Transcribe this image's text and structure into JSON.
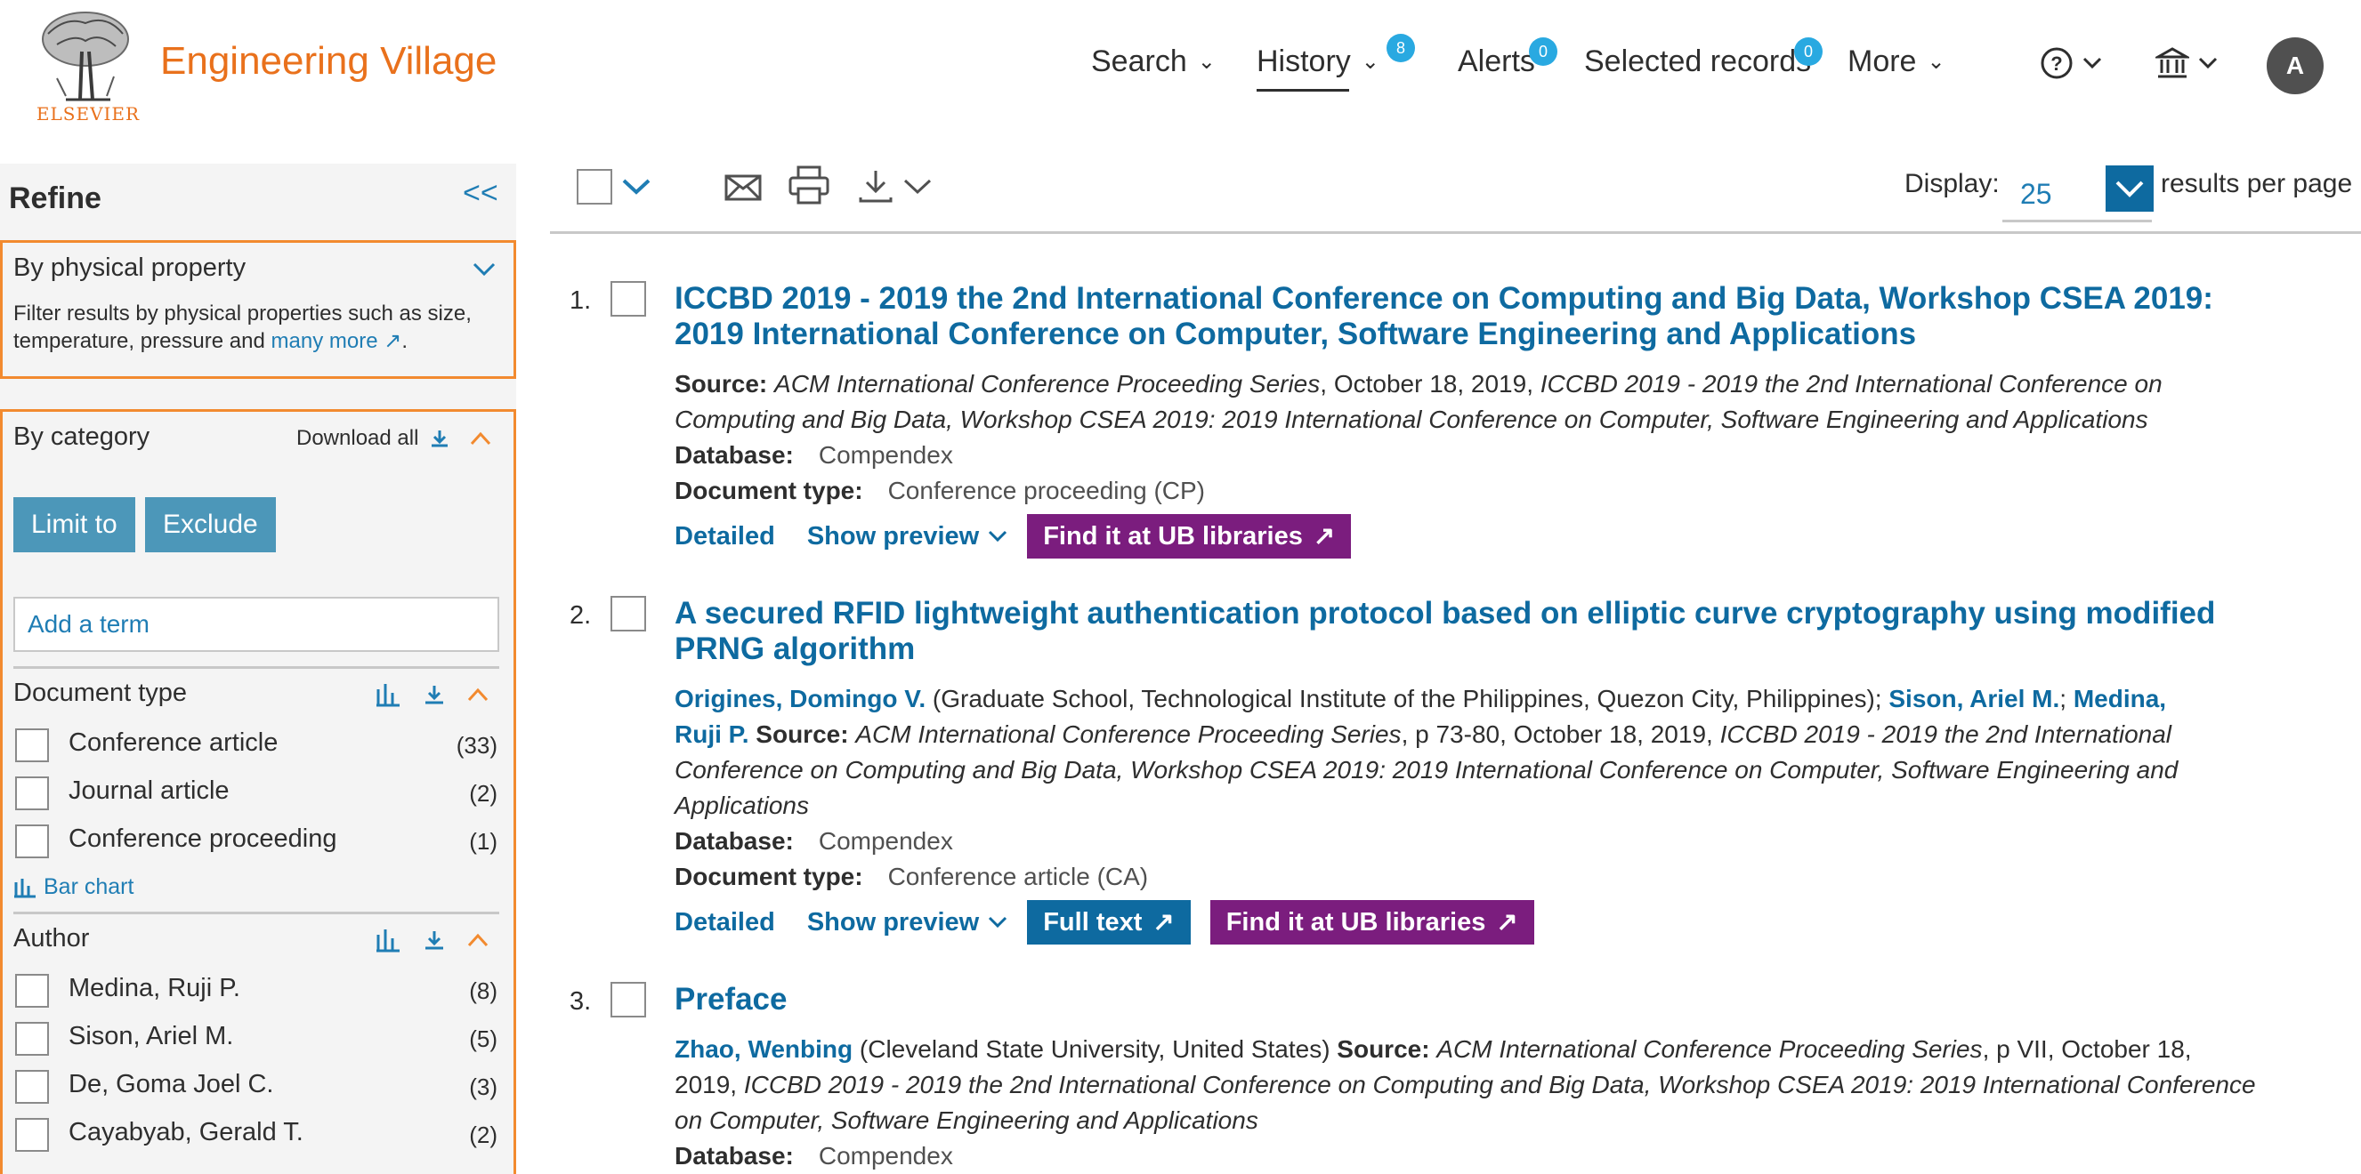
{
  "header": {
    "logo_text": "ELSEVIER",
    "brand": "Engineering Village",
    "nav": [
      {
        "label": "Search"
      },
      {
        "label": "History",
        "badge": "8"
      },
      {
        "label": "Alerts",
        "badge": "0"
      },
      {
        "label": "Selected records",
        "badge": "0"
      },
      {
        "label": "More"
      }
    ],
    "avatar": "A",
    "icons": [
      "help-icon",
      "institution-icon"
    ]
  },
  "sidebar": {
    "title": "Refine",
    "collapse": "<<",
    "physical": {
      "heading": "By physical property",
      "desc_1": "Filter results by physical properties such as size,",
      "desc_2": "temperature, pressure and",
      "link": "many more",
      "tail": "."
    },
    "category": {
      "heading": "By category",
      "download_all": "Download all",
      "limit_to": "Limit to",
      "exclude": "Exclude",
      "add_term_placeholder": "Add a term"
    },
    "facets": {
      "doc_type": {
        "title": "Document type",
        "items": [
          {
            "label": "Conference article",
            "count": "(33)"
          },
          {
            "label": "Journal article",
            "count": "(2)"
          },
          {
            "label": "Conference proceeding",
            "count": "(1)"
          }
        ],
        "bar_chart": "Bar chart"
      },
      "author": {
        "title": "Author",
        "items": [
          {
            "label": "Medina, Ruji P.",
            "count": "(8)"
          },
          {
            "label": "Sison, Ariel M.",
            "count": "(5)"
          },
          {
            "label": "De, Goma Joel C.",
            "count": "(3)"
          },
          {
            "label": "Cayabyab, Gerald T.",
            "count": "(2)"
          }
        ]
      }
    }
  },
  "toolbar": {
    "display_label": "Display:",
    "display_value": "25",
    "rpp_label": "results per page",
    "icons": [
      "email-icon",
      "print-icon",
      "download-icon"
    ]
  },
  "results": [
    {
      "num": "1.",
      "title_1": "ICCBD 2019 - 2019 the 2nd International Conference on Computing and Big Data, Workshop CSEA 2019:",
      "title_2": "2019 International Conference on Computer, Software Engineering and Applications",
      "source_label": "Source:",
      "source_series": "ACM International Conference Proceeding Series",
      "source_date": ", October 18, 2019, ",
      "source_conf_1": "ICCBD 2019 - 2019 the 2nd International Conference on",
      "source_conf_2": "Computing and Big Data, Workshop CSEA 2019: 2019 International Conference on Computer, Software Engineering and Applications",
      "db_label": "Database:",
      "db_value": "Compendex",
      "type_label": "Document type:",
      "type_value": "Conference proceeding (CP)",
      "detailed": "Detailed",
      "preview": "Show preview",
      "find": "Find it at UB libraries"
    },
    {
      "num": "2.",
      "title_1": "A secured RFID lightweight authentication protocol based on elliptic curve cryptography using modified",
      "title_2": "PRNG algorithm",
      "author_1": "Origines, Domingo V.",
      "affil_1": " (Graduate School, Technological Institute of the Philippines, Quezon City, Philippines); ",
      "author_2": "Sison, Ariel M.",
      "sep": "; ",
      "author_3a": "Medina,",
      "author_3b": "Ruji P.",
      "source_label": "Source:",
      "source_series": "ACM International Conference Proceeding Series",
      "source_pages": ", p 73-80, October 18, 2019, ",
      "source_conf_1": "ICCBD 2019 - 2019 the 2nd International",
      "source_conf_2": "Conference on Computing and Big Data, Workshop CSEA 2019: 2019 International Conference on Computer, Software Engineering and",
      "source_conf_3": "Applications",
      "db_label": "Database:",
      "db_value": "Compendex",
      "type_label": "Document type:",
      "type_value": "Conference article (CA)",
      "detailed": "Detailed",
      "preview": "Show preview",
      "full_text": "Full text",
      "find": "Find it at UB libraries"
    },
    {
      "num": "3.",
      "title_1": "Preface",
      "author_1": "Zhao, Wenbing",
      "affil_1": " (Cleveland State University, United States) ",
      "source_label": "Source:",
      "source_series": "ACM International Conference Proceeding Series",
      "source_pages": ", p VII, October 18,",
      "source_year": "2019, ",
      "source_conf_1": "ICCBD 2019 - 2019 the 2nd International Conference on Computing and Big Data, Workshop CSEA 2019: 2019 International Conference",
      "source_conf_2": "on Computer, Software Engineering and Applications",
      "db_label": "Database:",
      "db_value": "Compendex"
    }
  ],
  "colors": {
    "brand_orange": "#e9711c",
    "link_blue": "#0e6aa0",
    "badge_blue": "#29a9e1",
    "purple": "#7b1d7e",
    "teal_button": "#4c97b9"
  }
}
